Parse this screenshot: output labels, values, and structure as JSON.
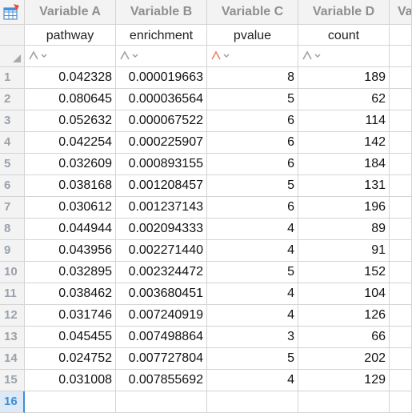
{
  "columns": [
    {
      "variable": "Variable A",
      "name": "pathway",
      "spark": "#a0a0a0"
    },
    {
      "variable": "Variable B",
      "name": "enrichment",
      "spark": "#a0a0a0"
    },
    {
      "variable": "Variable C",
      "name": "pvalue",
      "spark": "#e8836b"
    },
    {
      "variable": "Variable D",
      "name": "count",
      "spark": "#a0a0a0"
    },
    {
      "variable": "Va",
      "name": "",
      "spark": ""
    }
  ],
  "row_numbers": [
    "1",
    "2",
    "3",
    "4",
    "5",
    "6",
    "7",
    "8",
    "9",
    "10",
    "11",
    "12",
    "13",
    "14",
    "15",
    "16"
  ],
  "active_row": "16",
  "rows": [
    [
      "0.042328",
      "0.000019663",
      "8",
      "189"
    ],
    [
      "0.080645",
      "0.000036564",
      "5",
      "62"
    ],
    [
      "0.052632",
      "0.000067522",
      "6",
      "114"
    ],
    [
      "0.042254",
      "0.000225907",
      "6",
      "142"
    ],
    [
      "0.032609",
      "0.000893155",
      "6",
      "184"
    ],
    [
      "0.038168",
      "0.001208457",
      "5",
      "131"
    ],
    [
      "0.030612",
      "0.001237143",
      "6",
      "196"
    ],
    [
      "0.044944",
      "0.002094333",
      "4",
      "89"
    ],
    [
      "0.043956",
      "0.002271440",
      "4",
      "91"
    ],
    [
      "0.032895",
      "0.002324472",
      "5",
      "152"
    ],
    [
      "0.038462",
      "0.003680451",
      "4",
      "104"
    ],
    [
      "0.031746",
      "0.007240919",
      "4",
      "126"
    ],
    [
      "0.045455",
      "0.007498864",
      "3",
      "66"
    ],
    [
      "0.024752",
      "0.007727804",
      "5",
      "202"
    ],
    [
      "0.031008",
      "0.007855692",
      "4",
      "129"
    ],
    [
      "",
      "",
      "",
      ""
    ]
  ],
  "icons": {
    "corner": "table-grid-icon",
    "filter": "sparkline-icon"
  },
  "colors": {
    "grid": "#d4d4d4",
    "header_bg": "#f3f3f3",
    "active_row": "#3b8fd9",
    "sheet_icon": "#e84c3d"
  }
}
